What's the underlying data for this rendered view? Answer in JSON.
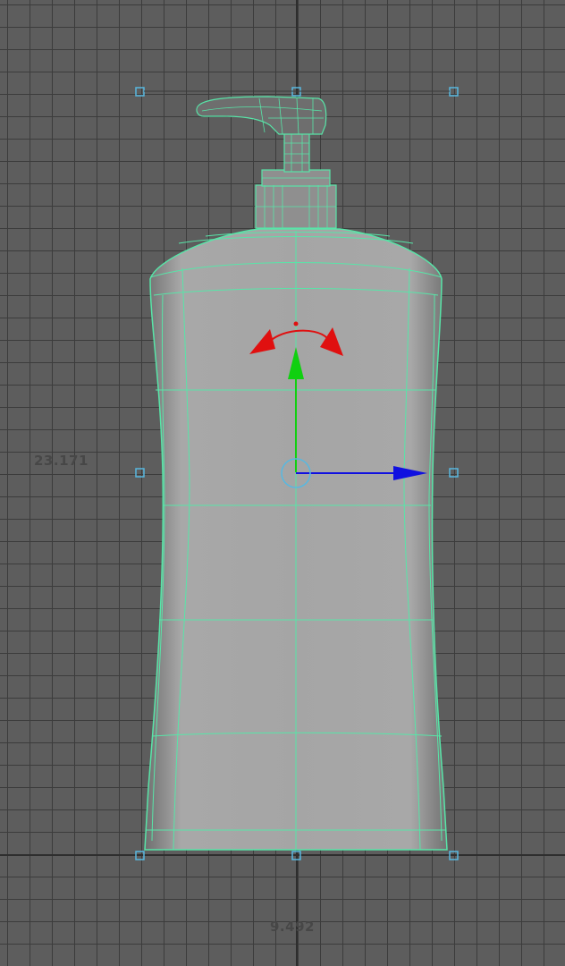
{
  "viewport": {
    "height_dimension": "23.171",
    "width_dimension": "9.492"
  },
  "colors": {
    "background": "#5d5d5d",
    "grid": "#3c3c3c",
    "wireframe": "#58e5a8",
    "bottle_fill": "#a2a2a2",
    "manip_x": "#1010e0",
    "manip_y": "#10d010",
    "manip_rotate": "#e01010",
    "handles": "#58b8e0"
  },
  "icons": [
    "move-x-arrow-icon",
    "move-y-arrow-icon",
    "rotate-arrow-icon",
    "pivot-circle-icon",
    "bounding-box-handle-icon"
  ]
}
